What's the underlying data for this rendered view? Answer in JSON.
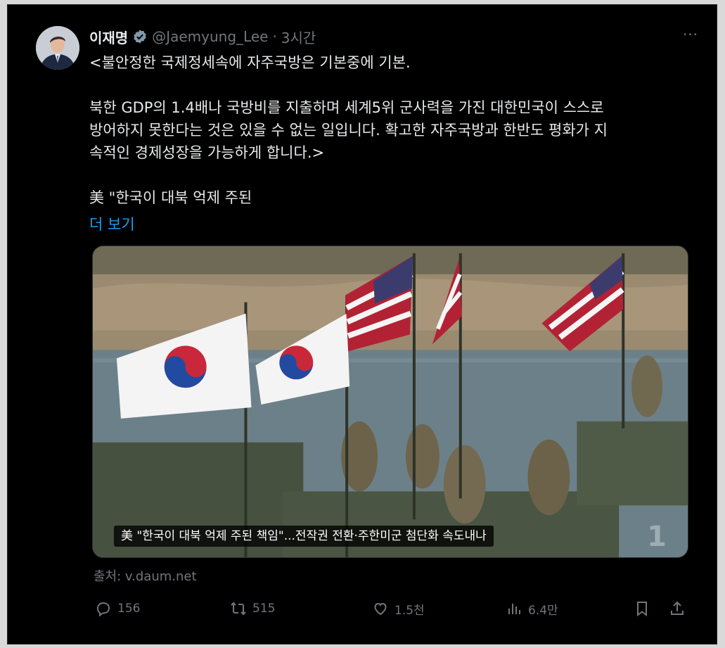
{
  "tweet": {
    "author_name": "이재명",
    "handle": "@Jaemyung_Lee",
    "separator": "·",
    "time": "3시간",
    "more": "···",
    "body": "<불안정한 국제정세속에 자주국방은 기본중에 기본.\n\n북한 GDP의 1.4배나 국방비를 지출하며 세계5위 군사력을 가진 대한민국이 스스로\n방어하지 못한다는 것은 있을 수 없는 일입니다. 확고한 자주국방과 한반도 평화가 지\n속적인 경제성장을 가능하게 합니다.>\n\n美 \"한국이 대북 억제 주된",
    "show_more": "더 보기"
  },
  "card": {
    "caption": "美 \"한국이 대북 억제 주된 책임\"...전작권 전환·주한미군 첨단화 속도내나",
    "source": "출처: v.daum.net"
  },
  "actions": {
    "replies": "156",
    "retweets": "515",
    "likes": "1.5천",
    "views": "6.4만"
  },
  "colors": {
    "background": "#000000",
    "text": "#e7e9ea",
    "muted": "#71767b",
    "link": "#1d9bf0",
    "verified": "#829aab"
  }
}
